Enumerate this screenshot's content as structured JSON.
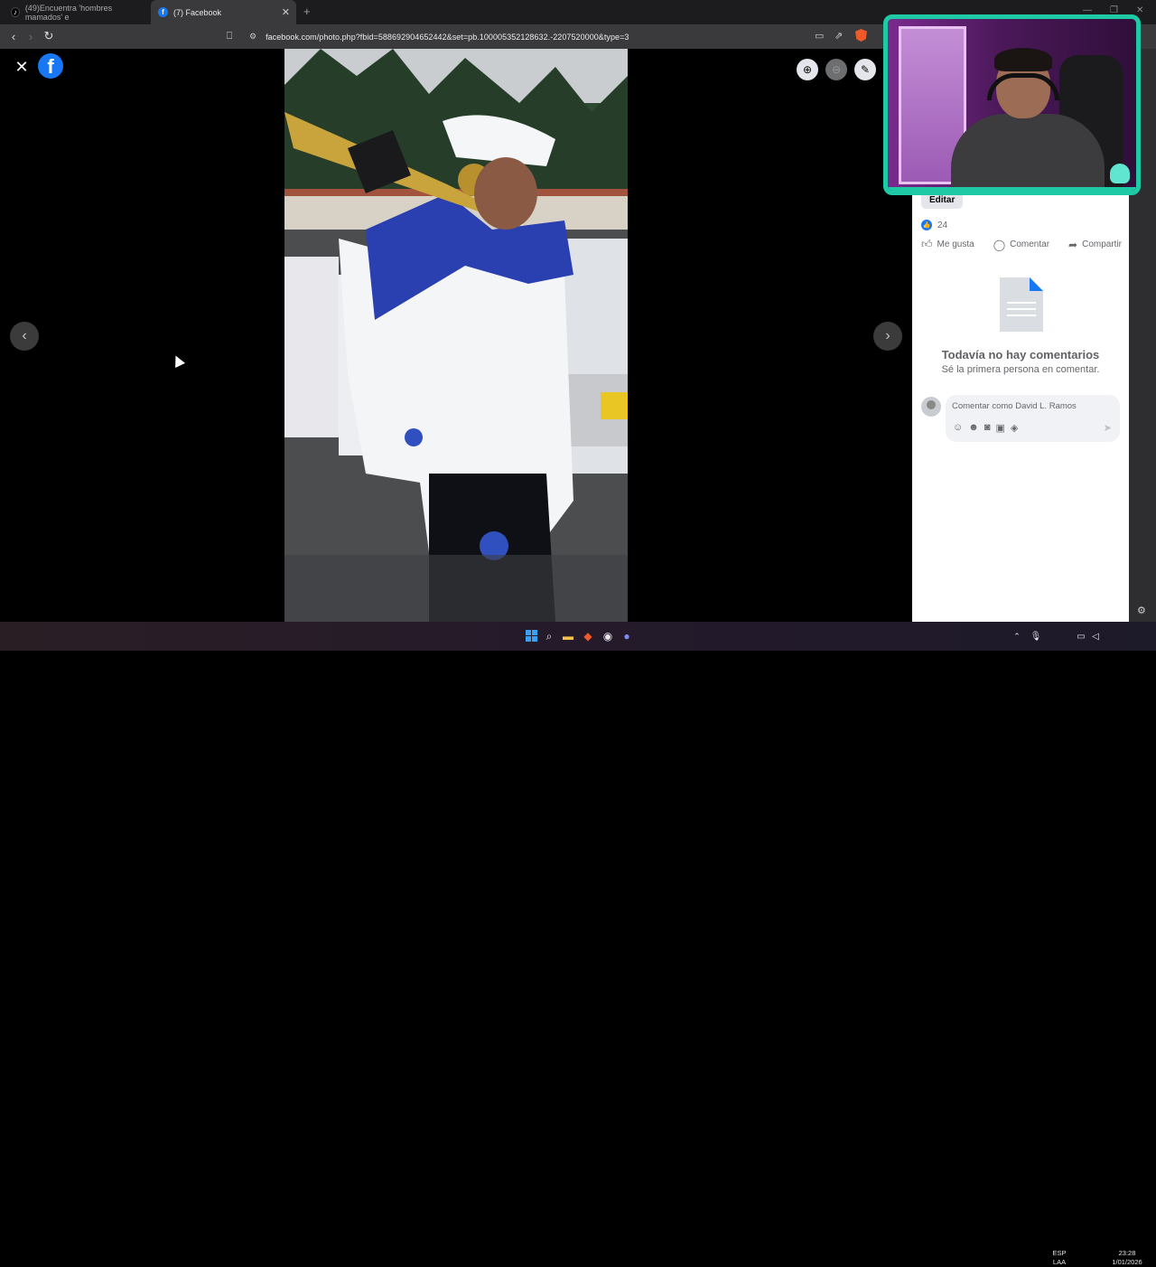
{
  "browser": {
    "tabs": [
      {
        "label": "(49)Encuentra 'hombres mamados' e",
        "favicon": "tiktok-icon"
      },
      {
        "label": "(7) Facebook",
        "favicon": "facebook-icon"
      }
    ],
    "url": "facebook.com/photo.php?fbid=588692904652442&set=pb.100005352128632.-2207520000&type=3"
  },
  "panel": {
    "edit_label": "Editar",
    "like_count": "24",
    "actions": {
      "like": "Me gusta",
      "comment": "Comentar",
      "share": "Compartir"
    },
    "empty_title": "Todavía no hay comentarios",
    "empty_subtitle": "Sé la primera persona en comentar.",
    "comment_placeholder": "Comentar como David L. Ramos"
  },
  "taskbar": {
    "lang_top": "ESP",
    "lang_bottom": "LAA",
    "time": "23:28",
    "date": "1/01/2026"
  },
  "colors": {
    "facebook_blue": "#1877f2",
    "webcam_border": "#1ec9a6"
  }
}
